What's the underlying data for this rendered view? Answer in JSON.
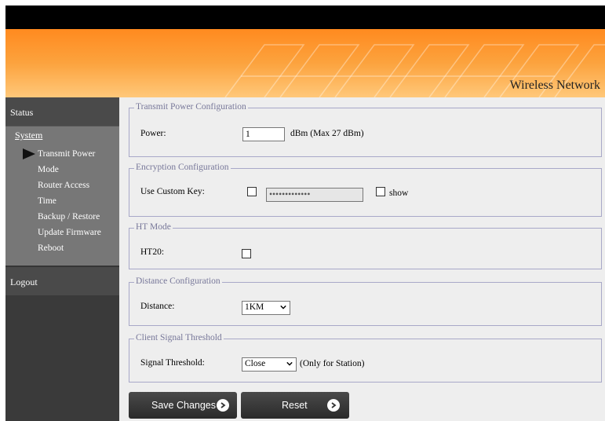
{
  "header": {
    "brand": "Wireless Network"
  },
  "sidebar": {
    "status": "Status",
    "system": "System",
    "items": [
      "Transmit Power",
      "Mode",
      "Router Access",
      "Time",
      "Backup / Restore",
      "Update Firmware",
      "Reboot"
    ],
    "active_item": "Transmit Power",
    "logout": "Logout"
  },
  "sections": {
    "transmit_power": {
      "legend": "Transmit Power Configuration",
      "label": "Power:",
      "value": "1",
      "unit": "dBm (Max 27 dBm)"
    },
    "encryption": {
      "legend": "Encryption Configuration",
      "label": "Use Custom Key:",
      "key_value": "•••••••••••••",
      "show_label": "show"
    },
    "ht_mode": {
      "legend": "HT Mode",
      "label": "HT20:"
    },
    "distance": {
      "legend": "Distance Configuration",
      "label": "Distance:",
      "selected": "1KM"
    },
    "signal": {
      "legend": "Client Signal Threshold",
      "label": "Signal Threshold:",
      "selected": "Close",
      "note": "(Only for Station)"
    }
  },
  "buttons": {
    "save": "Save Changes",
    "reset": "Reset"
  },
  "colors": {
    "banner": "#fca33e",
    "sidebar": "#3a3a3a",
    "sidebar_active": "#777777",
    "legend": "#777799"
  }
}
